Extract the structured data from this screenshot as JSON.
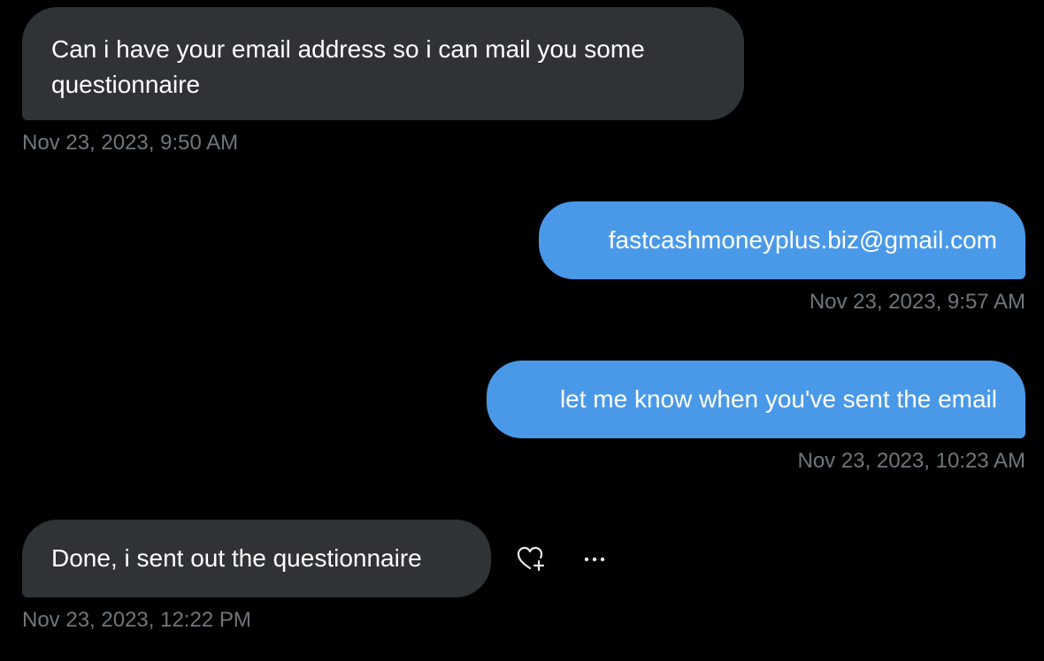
{
  "messages": [
    {
      "direction": "received",
      "text": "Can i have your email address so i can mail you some questionnaire",
      "timestamp": "Nov 23, 2023, 9:50 AM"
    },
    {
      "direction": "sent",
      "text": "fastcashmoneyplus.biz@gmail.com",
      "timestamp": "Nov 23, 2023, 9:57 AM"
    },
    {
      "direction": "sent",
      "text": "let me know when you've sent the email",
      "timestamp": "Nov 23, 2023, 10:23 AM"
    },
    {
      "direction": "received",
      "text": "Done, i sent out the questionnaire",
      "timestamp": "Nov 23, 2023, 12:22 PM"
    }
  ],
  "actions": {
    "react_icon": "heart-plus-icon",
    "more_icon": "more-horizontal-icon"
  },
  "colors": {
    "background": "#000000",
    "received_bubble": "#2f3336",
    "sent_bubble": "#4a99e9",
    "timestamp": "#71767b",
    "icon": "#e7e9ea"
  }
}
